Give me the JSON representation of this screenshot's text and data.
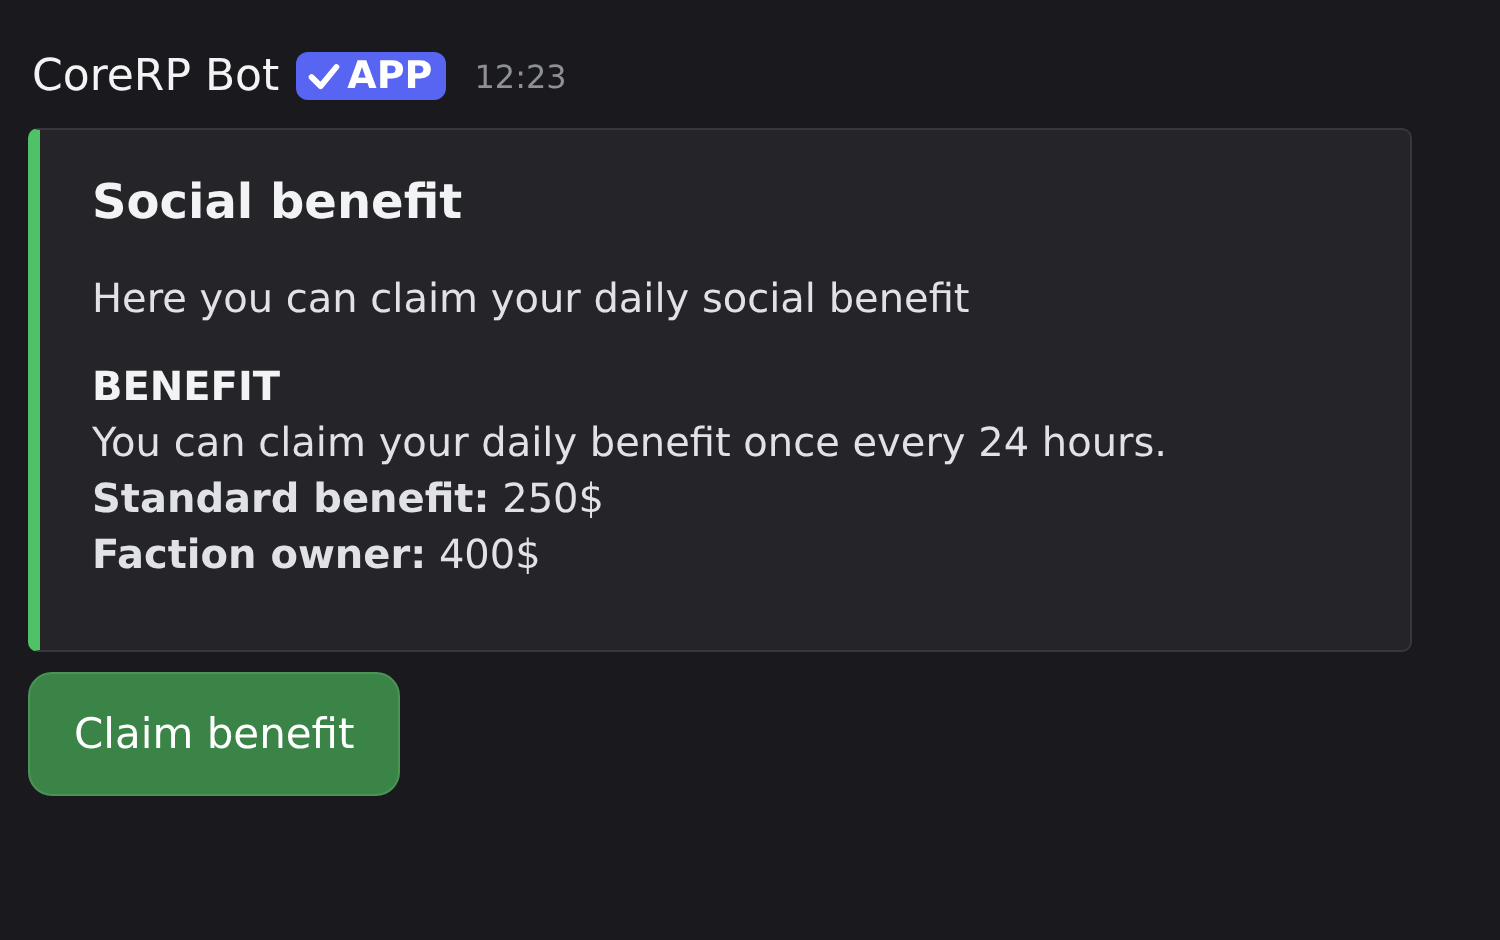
{
  "message": {
    "author": "CoreRP Bot",
    "badge": "APP",
    "time": "12:23"
  },
  "embed": {
    "title": "Social benefit",
    "description": "Here you can claim your daily social benefit",
    "field": {
      "name": "BENEFIT",
      "lines": [
        "You can claim your daily benefit once every 24 hours.",
        "**Standard benefit:** 250$",
        "**Faction owner:** 400$"
      ]
    }
  },
  "buttons": [
    {
      "label": "Claim benefit"
    }
  ]
}
